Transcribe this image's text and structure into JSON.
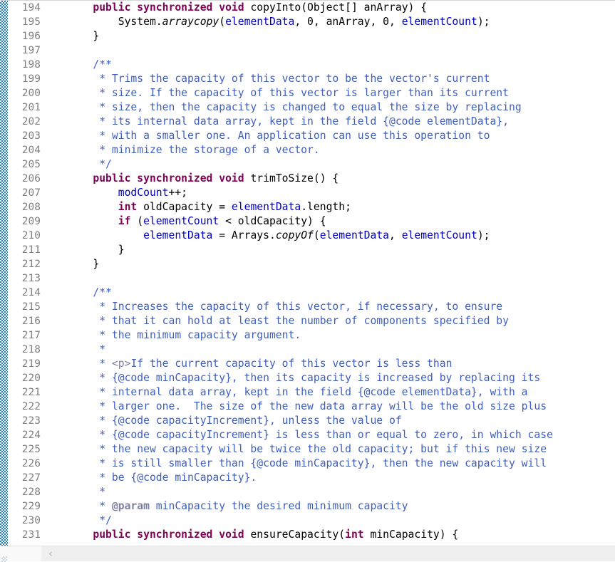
{
  "editor": {
    "language": "java",
    "first_line_number": 194,
    "last_line_number": 231,
    "line_height_px": 20,
    "colors": {
      "background": "#ffffff",
      "keyword": "#7f0055",
      "field": "#0000c0",
      "javadoc": "#3f5fbf",
      "javadoc_tag": "#7f7f9f",
      "line_number": "#808080",
      "change_ruler": "#1b7ec0"
    }
  },
  "gutter": {
    "lines": [
      {
        "num": "194",
        "fold": true
      },
      {
        "num": "195",
        "fold": false
      },
      {
        "num": "196",
        "fold": false
      },
      {
        "num": "197",
        "fold": false
      },
      {
        "num": "198",
        "fold": true
      },
      {
        "num": "199",
        "fold": false
      },
      {
        "num": "200",
        "fold": false
      },
      {
        "num": "201",
        "fold": false
      },
      {
        "num": "202",
        "fold": false
      },
      {
        "num": "203",
        "fold": false
      },
      {
        "num": "204",
        "fold": false
      },
      {
        "num": "205",
        "fold": false
      },
      {
        "num": "206",
        "fold": true
      },
      {
        "num": "207",
        "fold": false
      },
      {
        "num": "208",
        "fold": false
      },
      {
        "num": "209",
        "fold": false
      },
      {
        "num": "210",
        "fold": false
      },
      {
        "num": "211",
        "fold": false
      },
      {
        "num": "212",
        "fold": false
      },
      {
        "num": "213",
        "fold": false
      },
      {
        "num": "214",
        "fold": true
      },
      {
        "num": "215",
        "fold": false
      },
      {
        "num": "216",
        "fold": false
      },
      {
        "num": "217",
        "fold": false
      },
      {
        "num": "218",
        "fold": false
      },
      {
        "num": "219",
        "fold": false
      },
      {
        "num": "220",
        "fold": false
      },
      {
        "num": "221",
        "fold": false
      },
      {
        "num": "222",
        "fold": false
      },
      {
        "num": "223",
        "fold": false
      },
      {
        "num": "224",
        "fold": false
      },
      {
        "num": "225",
        "fold": false
      },
      {
        "num": "226",
        "fold": false
      },
      {
        "num": "227",
        "fold": false
      },
      {
        "num": "228",
        "fold": false
      },
      {
        "num": "229",
        "fold": false
      },
      {
        "num": "230",
        "fold": false
      },
      {
        "num": "231",
        "fold": true
      }
    ]
  },
  "code": {
    "lines": [
      {
        "tokens": [
          {
            "t": "    ",
            "c": "plain"
          },
          {
            "t": "public",
            "c": "kw"
          },
          {
            "t": " ",
            "c": "plain"
          },
          {
            "t": "synchronized",
            "c": "kw"
          },
          {
            "t": " ",
            "c": "plain"
          },
          {
            "t": "void",
            "c": "kw"
          },
          {
            "t": " copyInto(Object[] anArray) {",
            "c": "plain"
          }
        ]
      },
      {
        "tokens": [
          {
            "t": "        System.",
            "c": "plain"
          },
          {
            "t": "arraycopy",
            "c": "stat"
          },
          {
            "t": "(",
            "c": "plain"
          },
          {
            "t": "elementData",
            "c": "fld"
          },
          {
            "t": ", 0, anArray, 0, ",
            "c": "plain"
          },
          {
            "t": "elementCount",
            "c": "fld"
          },
          {
            "t": ");",
            "c": "plain"
          }
        ]
      },
      {
        "tokens": [
          {
            "t": "    }",
            "c": "plain"
          }
        ]
      },
      {
        "tokens": [
          {
            "t": "",
            "c": "plain"
          }
        ]
      },
      {
        "tokens": [
          {
            "t": "    /**",
            "c": "cmt"
          }
        ]
      },
      {
        "tokens": [
          {
            "t": "     * Trims the capacity of this vector to be the vector's current",
            "c": "cmt"
          }
        ]
      },
      {
        "tokens": [
          {
            "t": "     * size. If the capacity of this vector is larger than its current",
            "c": "cmt"
          }
        ]
      },
      {
        "tokens": [
          {
            "t": "     * size, then the capacity is changed to equal the size by replacing",
            "c": "cmt"
          }
        ]
      },
      {
        "tokens": [
          {
            "t": "     * its internal data array, kept in the field {@code elementData},",
            "c": "cmt"
          }
        ]
      },
      {
        "tokens": [
          {
            "t": "     * with a smaller one. An application can use this operation to",
            "c": "cmt"
          }
        ]
      },
      {
        "tokens": [
          {
            "t": "     * minimize the storage of a vector.",
            "c": "cmt"
          }
        ]
      },
      {
        "tokens": [
          {
            "t": "     */",
            "c": "cmt"
          }
        ]
      },
      {
        "tokens": [
          {
            "t": "    ",
            "c": "plain"
          },
          {
            "t": "public",
            "c": "kw"
          },
          {
            "t": " ",
            "c": "plain"
          },
          {
            "t": "synchronized",
            "c": "kw"
          },
          {
            "t": " ",
            "c": "plain"
          },
          {
            "t": "void",
            "c": "kw"
          },
          {
            "t": " trimToSize() {",
            "c": "plain"
          }
        ]
      },
      {
        "tokens": [
          {
            "t": "        ",
            "c": "plain"
          },
          {
            "t": "modCount",
            "c": "fld"
          },
          {
            "t": "++;",
            "c": "plain"
          }
        ]
      },
      {
        "tokens": [
          {
            "t": "        ",
            "c": "plain"
          },
          {
            "t": "int",
            "c": "kw"
          },
          {
            "t": " oldCapacity = ",
            "c": "plain"
          },
          {
            "t": "elementData",
            "c": "fld"
          },
          {
            "t": ".length;",
            "c": "plain"
          }
        ]
      },
      {
        "tokens": [
          {
            "t": "        ",
            "c": "plain"
          },
          {
            "t": "if",
            "c": "kw"
          },
          {
            "t": " (",
            "c": "plain"
          },
          {
            "t": "elementCount",
            "c": "fld"
          },
          {
            "t": " < oldCapacity) {",
            "c": "plain"
          }
        ]
      },
      {
        "tokens": [
          {
            "t": "            ",
            "c": "plain"
          },
          {
            "t": "elementData",
            "c": "fld"
          },
          {
            "t": " = Arrays.",
            "c": "plain"
          },
          {
            "t": "copyOf",
            "c": "stat"
          },
          {
            "t": "(",
            "c": "plain"
          },
          {
            "t": "elementData",
            "c": "fld"
          },
          {
            "t": ", ",
            "c": "plain"
          },
          {
            "t": "elementCount",
            "c": "fld"
          },
          {
            "t": ");",
            "c": "plain"
          }
        ]
      },
      {
        "tokens": [
          {
            "t": "        }",
            "c": "plain"
          }
        ]
      },
      {
        "tokens": [
          {
            "t": "    }",
            "c": "plain"
          }
        ]
      },
      {
        "tokens": [
          {
            "t": "",
            "c": "plain"
          }
        ]
      },
      {
        "tokens": [
          {
            "t": "    /**",
            "c": "cmt"
          }
        ]
      },
      {
        "tokens": [
          {
            "t": "     * Increases the capacity of this vector, if necessary, to ensure",
            "c": "cmt"
          }
        ]
      },
      {
        "tokens": [
          {
            "t": "     * that it can hold at least the number of components specified by",
            "c": "cmt"
          }
        ]
      },
      {
        "tokens": [
          {
            "t": "     * the minimum capacity argument.",
            "c": "cmt"
          }
        ]
      },
      {
        "tokens": [
          {
            "t": "     *",
            "c": "cmt"
          }
        ]
      },
      {
        "tokens": [
          {
            "t": "     * ",
            "c": "cmt"
          },
          {
            "t": "<p>",
            "c": "cmt-htm"
          },
          {
            "t": "If the current capacity of this vector is less than",
            "c": "cmt"
          }
        ]
      },
      {
        "tokens": [
          {
            "t": "     * {@code minCapacity}, then its capacity is increased by replacing its",
            "c": "cmt"
          }
        ]
      },
      {
        "tokens": [
          {
            "t": "     * internal data array, kept in the field {@code elementData}, with a",
            "c": "cmt"
          }
        ]
      },
      {
        "tokens": [
          {
            "t": "     * larger one.  The size of the new data array will be the old size plus",
            "c": "cmt"
          }
        ]
      },
      {
        "tokens": [
          {
            "t": "     * {@code capacityIncrement}, unless the value of",
            "c": "cmt"
          }
        ]
      },
      {
        "tokens": [
          {
            "t": "     * {@code capacityIncrement} is less than or equal to zero, in which case",
            "c": "cmt"
          }
        ]
      },
      {
        "tokens": [
          {
            "t": "     * the new capacity will be twice the old capacity; but if this new size",
            "c": "cmt"
          }
        ]
      },
      {
        "tokens": [
          {
            "t": "     * is still smaller than {@code minCapacity}, then the new capacity will",
            "c": "cmt"
          }
        ]
      },
      {
        "tokens": [
          {
            "t": "     * be {@code minCapacity}.",
            "c": "cmt"
          }
        ]
      },
      {
        "tokens": [
          {
            "t": "     *",
            "c": "cmt"
          }
        ]
      },
      {
        "tokens": [
          {
            "t": "     * ",
            "c": "cmt"
          },
          {
            "t": "@param",
            "c": "cmt-tag"
          },
          {
            "t": " minCapacity the desired minimum capacity",
            "c": "cmt"
          }
        ]
      },
      {
        "tokens": [
          {
            "t": "     */",
            "c": "cmt"
          }
        ]
      },
      {
        "tokens": [
          {
            "t": "    ",
            "c": "plain"
          },
          {
            "t": "public",
            "c": "kw"
          },
          {
            "t": " ",
            "c": "plain"
          },
          {
            "t": "synchronized",
            "c": "kw"
          },
          {
            "t": " ",
            "c": "plain"
          },
          {
            "t": "void",
            "c": "kw"
          },
          {
            "t": " ensureCapacity(",
            "c": "plain"
          },
          {
            "t": "int",
            "c": "kw"
          },
          {
            "t": " minCapacity) {",
            "c": "plain"
          }
        ]
      }
    ]
  },
  "scrollbar": {
    "left_arrow_glyph": "‹",
    "orientation": "horizontal"
  }
}
